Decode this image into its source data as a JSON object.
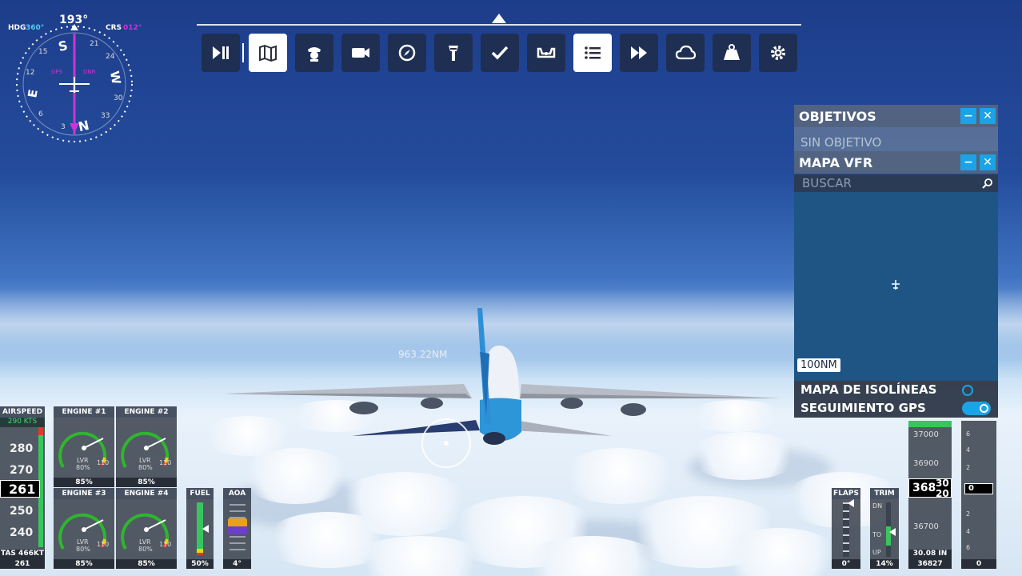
{
  "compass": {
    "hdg_label": "HDG",
    "hdg_value": "360°",
    "crs_label": "CRS",
    "crs_value": "012°",
    "heading_readout": "193°",
    "gps_label": "GPS",
    "dme_label": "DNR",
    "card_labels": [
      "S",
      "E",
      "N",
      "W",
      "3",
      "6",
      "12",
      "15",
      "21",
      "24",
      "30",
      "33"
    ]
  },
  "toolbar": {
    "items": [
      {
        "name": "pause-play",
        "icon": "play-pause-icon",
        "active": false
      },
      {
        "name": "map",
        "icon": "map-icon",
        "active": true
      },
      {
        "name": "pilot",
        "icon": "pilot-icon",
        "active": false
      },
      {
        "name": "camera",
        "icon": "camera-icon",
        "active": false
      },
      {
        "name": "navlog",
        "icon": "compass-icon",
        "active": false
      },
      {
        "name": "atc",
        "icon": "tower-icon",
        "active": false
      },
      {
        "name": "checklist",
        "icon": "check-icon",
        "active": false
      },
      {
        "name": "controls",
        "icon": "yoke-icon",
        "active": false
      },
      {
        "name": "objectives",
        "icon": "list-icon",
        "active": true
      },
      {
        "name": "sim-rate",
        "icon": "fast-forward-icon",
        "active": false
      },
      {
        "name": "weather",
        "icon": "cloud-icon",
        "active": false
      },
      {
        "name": "weight",
        "icon": "weight-icon",
        "active": false
      },
      {
        "name": "settings",
        "icon": "gear-icon",
        "active": false
      }
    ]
  },
  "objectives_panel": {
    "title": "OBJETIVOS",
    "empty_text": "SIN OBJETIVO"
  },
  "vfr_panel": {
    "title": "MAPA VFR",
    "search_placeholder": "BUSCAR",
    "scale": "100NM",
    "options": [
      {
        "label": "MAPA DE ISOLÍNEAS",
        "on": false
      },
      {
        "label": "SEGUIMIENTO GPS",
        "on": true
      }
    ]
  },
  "scene": {
    "distance_label": "963.22NM"
  },
  "airspeed": {
    "title": "AIRSPEED",
    "box_top": "290 KTS",
    "ticks": [
      "280",
      "270",
      "250",
      "240"
    ],
    "current": "261",
    "tas_label": "TAS 466KT",
    "footer": "261"
  },
  "engines": [
    {
      "title": "ENGINE #1",
      "lvr": "LVR",
      "lvr_val": "80%",
      "max": "110",
      "footer": "85%"
    },
    {
      "title": "ENGINE #2",
      "lvr": "LVR",
      "lvr_val": "80%",
      "max": "110",
      "footer": "85%"
    },
    {
      "title": "ENGINE #3",
      "lvr": "LVR",
      "lvr_val": "80%",
      "max": "110",
      "footer": "85%"
    },
    {
      "title": "ENGINE #4",
      "lvr": "LVR",
      "lvr_val": "80%",
      "max": "110",
      "footer": "85%"
    }
  ],
  "fuel": {
    "title": "FUEL",
    "footer": "50%",
    "level": 0.5
  },
  "aoa": {
    "title": "AOA",
    "footer": "4°"
  },
  "flaps": {
    "title": "FLAPS",
    "footer": "0°"
  },
  "trim": {
    "title": "TRIM",
    "dn": "DN",
    "to": "TO",
    "up": "UP",
    "footer": "14%"
  },
  "altitude": {
    "ticks": [
      "37000",
      "36900",
      "36700"
    ],
    "current": "368",
    "roll_top": "30",
    "roll_bottom": "20",
    "baro": "30.08 IN",
    "footer": "36827"
  },
  "vsi": {
    "ticks": [
      "6",
      "4",
      "2",
      "2",
      "4",
      "6"
    ],
    "current": "0",
    "footer": "0"
  },
  "colors": {
    "accent": "#1aa3e6",
    "gauge_green": "#2fb52f",
    "gauge_yellow": "#e8d31a",
    "gauge_red": "#e03a2a",
    "compass_magenta": "#d132d4"
  }
}
